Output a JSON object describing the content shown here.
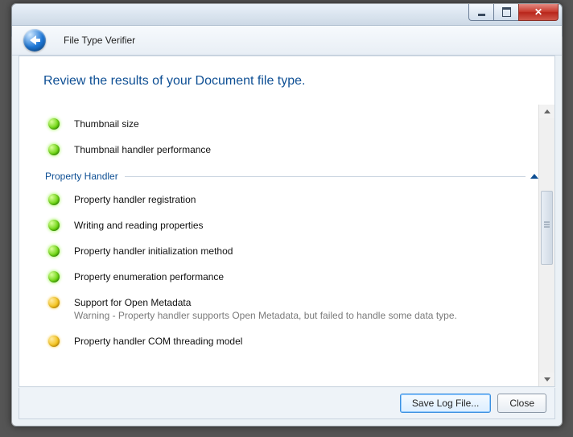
{
  "window": {
    "app_title": "File Type Verifier"
  },
  "heading": "Review the results of your Document file type.",
  "top_results": [
    {
      "status": "ok",
      "label": "Thumbnail size"
    },
    {
      "status": "ok",
      "label": "Thumbnail handler performance"
    }
  ],
  "group": {
    "title": "Property Handler"
  },
  "group_results": [
    {
      "status": "ok",
      "label": "Property handler registration"
    },
    {
      "status": "ok",
      "label": "Writing and reading properties"
    },
    {
      "status": "ok",
      "label": "Property handler initialization method"
    },
    {
      "status": "ok",
      "label": "Property enumeration performance"
    },
    {
      "status": "warn",
      "label": "Support for Open Metadata",
      "sub": "Warning - Property handler supports Open Metadata, but failed to handle some data type."
    },
    {
      "status": "warn",
      "label": "Property handler COM threading model"
    }
  ],
  "buttons": {
    "save_log": "Save Log File...",
    "close": "Close"
  }
}
